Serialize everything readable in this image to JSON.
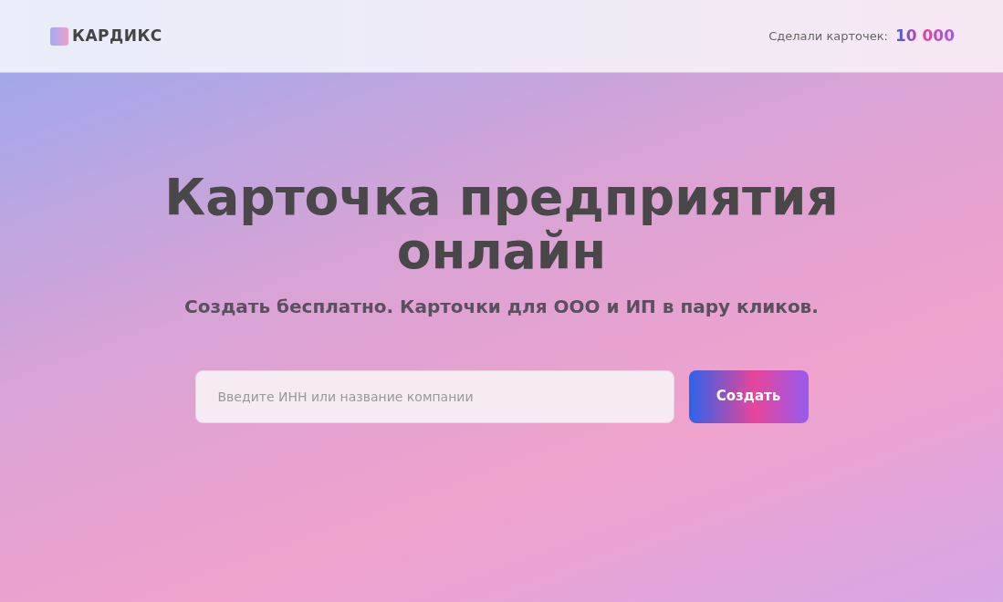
{
  "header": {
    "logo": "КАРДИКС",
    "counter_label": "Сделали карточек:",
    "counter_value": "10 000"
  },
  "hero": {
    "title": "Карточка предприятия онлайн",
    "subtitle": "Создать бесплатно. Карточки для ООО и ИП в пару кликов."
  },
  "search": {
    "placeholder": "Введите ИНН или название компании",
    "button": "Создать"
  }
}
